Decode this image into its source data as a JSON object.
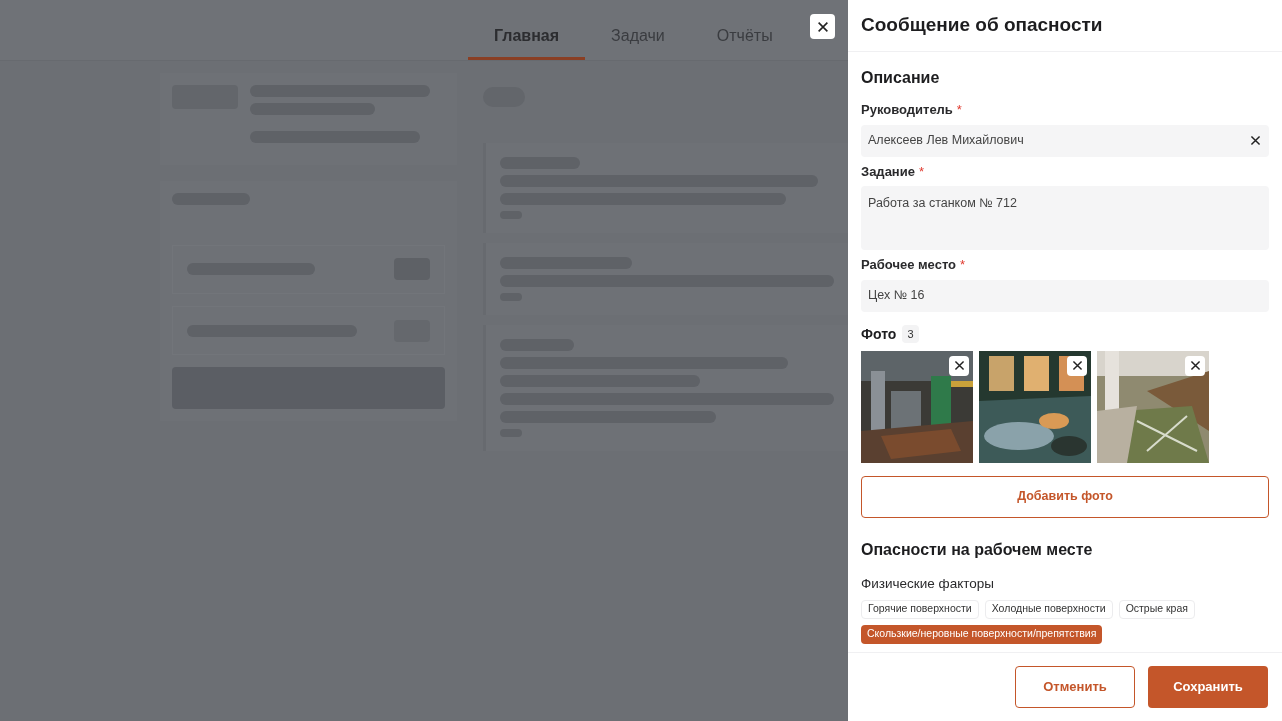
{
  "tabs": [
    {
      "label": "Главная",
      "selected": true
    },
    {
      "label": "Задачи",
      "selected": false
    },
    {
      "label": "Отчёты",
      "selected": false
    }
  ],
  "dialog": {
    "title": "Сообщение об опасности",
    "section_title": "Описание",
    "fields": [
      {
        "label": "Руководитель",
        "required_mark": "*",
        "value": "Алексеев Лев Михайлович",
        "kind": "select"
      },
      {
        "label": "Задание",
        "required_mark": "*",
        "value": "Работа за станком № 712",
        "kind": "textarea"
      },
      {
        "label": "Рабочее место",
        "required_mark": "*",
        "value": "Цех № 16",
        "kind": "text"
      }
    ],
    "photos": {
      "label": "Фото",
      "count": "3"
    },
    "add_photo_button": "Добавить фото",
    "hazards": {
      "title": "Опасности на рабочем месте",
      "groups": [
        {
          "title": "Физические факторы",
          "chips": [
            {
              "label": "Горячие поверхности",
              "selected": false
            },
            {
              "label": "Холодные поверхности",
              "selected": false
            },
            {
              "label": "Острые края",
              "selected": false
            },
            {
              "label": "Скользкие/неровные поверхности/препятствия",
              "selected": true
            }
          ]
        }
      ]
    },
    "buttons": [
      {
        "label": "Отменить",
        "kind": "secondary"
      },
      {
        "label": "Сохранить",
        "kind": "primary"
      }
    ]
  }
}
